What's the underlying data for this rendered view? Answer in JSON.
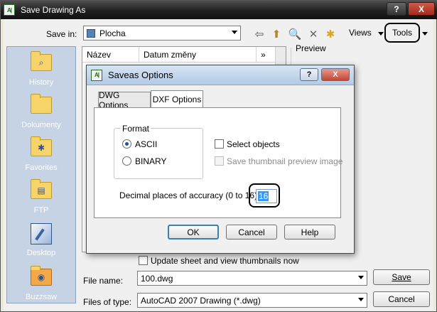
{
  "main": {
    "title": "Save Drawing As",
    "help_label": "?",
    "close_label": "X",
    "save_in_label": "Save in:",
    "save_in_value": "Plocha",
    "views_label": "Views",
    "tools_label": "Tools",
    "columns": [
      "Název",
      "Datum změny"
    ],
    "more_columns": "»",
    "preview_label": "Preview",
    "update_thumbnails_label": "Update sheet and view thumbnails now",
    "file_name_label": "File name:",
    "file_name_value": "100.dwg",
    "files_of_type_label": "Files of type:",
    "files_of_type_value": "AutoCAD 2007 Drawing (*.dwg)",
    "save_button": "Save",
    "cancel_button": "Cancel"
  },
  "places": [
    {
      "label": "History",
      "icon": "history-folder-icon"
    },
    {
      "label": "Dokumenty",
      "icon": "documents-folder-icon"
    },
    {
      "label": "Favorites",
      "icon": "favorites-folder-icon"
    },
    {
      "label": "FTP",
      "icon": "ftp-folder-icon"
    },
    {
      "label": "Desktop",
      "icon": "desktop-icon"
    },
    {
      "label": "Buzzsaw",
      "icon": "buzzsaw-icon"
    }
  ],
  "dialog": {
    "title": "Saveas Options",
    "help_label": "?",
    "close_label": "X",
    "tabs": [
      "DWG Options",
      "DXF Options"
    ],
    "active_tab": "DXF Options",
    "format_label": "Format",
    "format_options": [
      "ASCII",
      "BINARY"
    ],
    "format_selected": "ASCII",
    "select_objects_label": "Select objects",
    "save_thumbnail_label": "Save thumbnail preview image",
    "decimal_label": "Decimal places of accuracy (0 to 16)",
    "decimal_value": "16",
    "ok_button": "OK",
    "cancel_button": "Cancel",
    "help_button": "Help"
  },
  "colors": {
    "highlight_selection": "#3399ff",
    "sidebar_bg": "#c5d3e4"
  }
}
